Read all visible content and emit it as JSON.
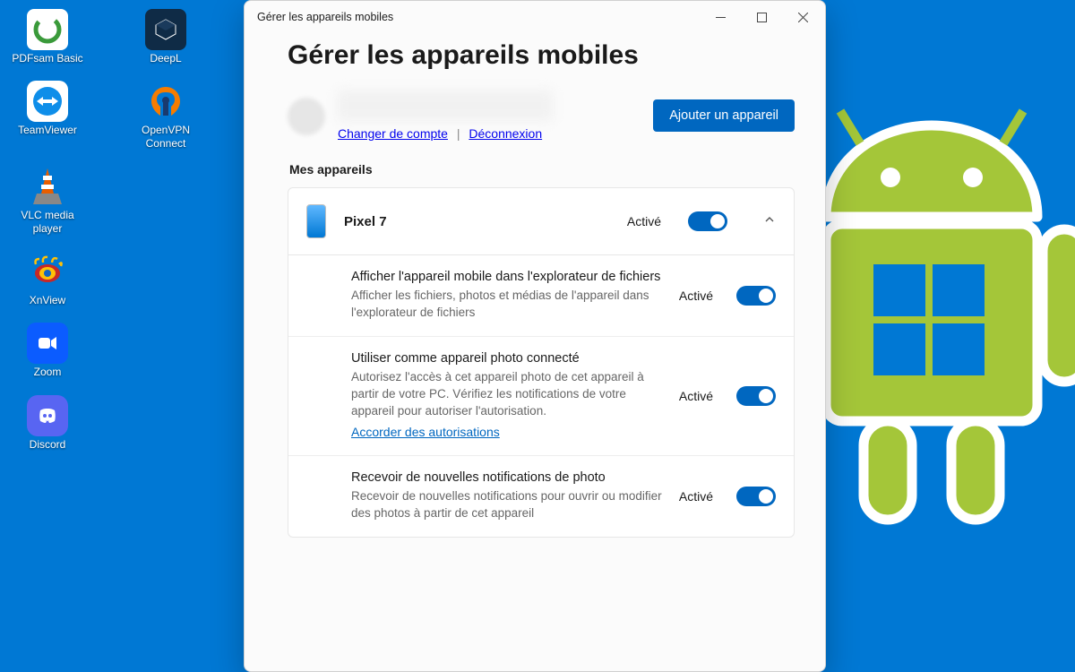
{
  "desktop": {
    "icons": [
      {
        "label": "PDFsam Basic"
      },
      {
        "label": "DeepL"
      },
      {
        "label": "TeamViewer"
      },
      {
        "label": "OpenVPN Connect"
      },
      {
        "label": "VLC media player"
      },
      {
        "label": "XnView"
      },
      {
        "label": "Zoom"
      },
      {
        "label": "Discord"
      }
    ]
  },
  "window": {
    "title": "Gérer les appareils mobiles",
    "heading": "Gérer les appareils mobiles",
    "account": {
      "change_link": "Changer de compte",
      "logout_link": "Déconnexion",
      "separator": "|"
    },
    "add_device_button": "Ajouter un appareil",
    "devices_section": "Mes appareils",
    "device": {
      "name": "Pixel 7",
      "status": "Activé"
    },
    "settings": [
      {
        "title": "Afficher l'appareil mobile dans l'explorateur de fichiers",
        "description": "Afficher les fichiers, photos et médias de l'appareil dans l'explorateur de fichiers",
        "status": "Activé"
      },
      {
        "title": "Utiliser comme appareil photo connecté",
        "description": "Autorisez l'accès à cet appareil photo de cet appareil à partir de votre PC. Vérifiez les notifications de votre appareil pour autoriser l'autorisation.",
        "link": "Accorder des autorisations",
        "status": "Activé"
      },
      {
        "title": "Recevoir de nouvelles notifications de photo",
        "description": "Recevoir de nouvelles notifications pour ouvrir ou modifier des photos à partir de cet appareil",
        "status": "Activé"
      }
    ]
  }
}
